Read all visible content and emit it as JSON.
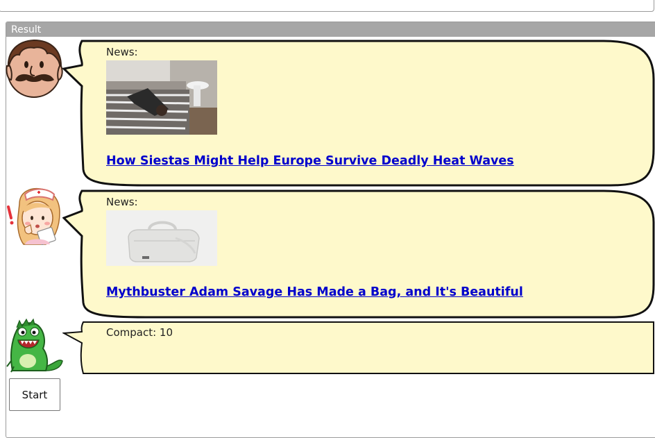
{
  "result_panel": {
    "title": "Result"
  },
  "messages": [
    {
      "avatar": "mustache-man-avatar",
      "label": "News:",
      "headline": "How Siestas Might Help Europe Survive Deadly Heat Waves"
    },
    {
      "avatar": "nurse-avatar",
      "label": "News:",
      "headline": "Mythbuster Adam Savage Has Made a Bag, and It's Beautiful"
    },
    {
      "avatar": "green-monster-avatar",
      "label": "Compact: 10"
    }
  ],
  "controls": {
    "start_label": "Start"
  },
  "colors": {
    "bubble_fill": "#fef9cb",
    "link": "#0000cc",
    "header_bg": "#a6a6a6"
  }
}
